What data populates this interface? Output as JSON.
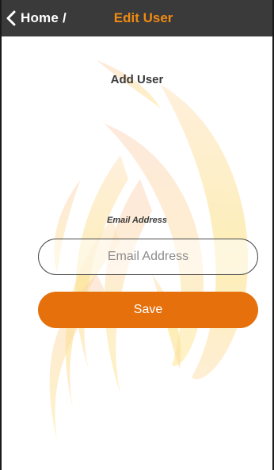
{
  "navbar": {
    "back_icon": "chevron-left-icon",
    "home_label": "Home",
    "separator": "/",
    "title": "Edit User"
  },
  "main": {
    "page_title": "Add User",
    "email_label": "Email Address",
    "email_placeholder": "Email Address",
    "email_value": "",
    "save_label": "Save"
  },
  "colors": {
    "navbar_bg": "#3a3a3a",
    "accent": "#e5700c",
    "title_accent": "#f08a12"
  }
}
